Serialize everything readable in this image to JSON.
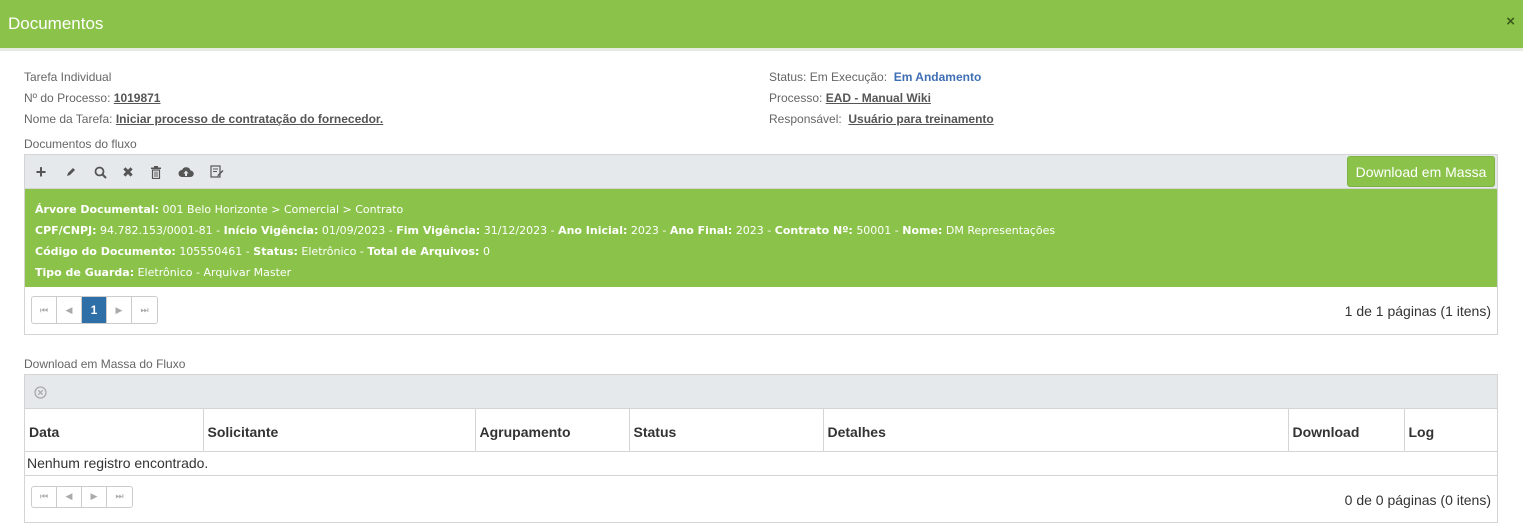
{
  "window": {
    "title": "Documentos",
    "close_label": "×"
  },
  "info_left": {
    "task_type": "Tarefa Individual",
    "process_number_label": "Nº do Processo:",
    "process_number": "1019871",
    "task_name_label": "Nome da Tarefa:",
    "task_name": "Iniciar processo de contratação do fornecedor."
  },
  "info_right": {
    "status_label": "Status: Em Execução:",
    "status_value": "Em Andamento",
    "process_label": "Processo:",
    "process_value": "EAD - Manual Wiki",
    "responsible_label": "Responsável:",
    "responsible_value": "Usuário para treinamento"
  },
  "flow_docs": {
    "section_label": "Documentos do fluxo",
    "toolbar_icons": [
      "add-icon",
      "edit-icon",
      "search-icon",
      "remove-icon",
      "delete-icon",
      "cloud-upload-icon",
      "edit-document-icon"
    ],
    "mass_download_button": "Download em Massa",
    "document": {
      "tree_label": "Árvore Documental:",
      "tree_value": "001 Belo Horizonte > Comercial > Contrato",
      "cpf_label": "CPF/CNPJ:",
      "cpf_value": "94.782.153/0001-81",
      "start_label": "Início Vigência:",
      "start_value": "01/09/2023",
      "end_label": "Fim Vigência:",
      "end_value": "31/12/2023",
      "year_start_label": "Ano Inicial:",
      "year_start_value": "2023",
      "year_end_label": "Ano Final:",
      "year_end_value": "2023",
      "contract_label": "Contrato Nº:",
      "contract_value": "50001",
      "name_label": "Nome:",
      "name_value": "DM Representações",
      "code_label": "Código do Documento:",
      "code_value": "105550461",
      "status_label": "Status:",
      "status_value": "Eletrônico",
      "files_label": "Total de Arquivos:",
      "files_value": "0",
      "guard_label": "Tipo de Guarda:",
      "guard_value": "Eletrônico - Arquivar Master",
      "separator": " - "
    },
    "pager": {
      "current_page": "1",
      "info": "1 de 1 páginas (1 itens)"
    }
  },
  "mass_download": {
    "section_label": "Download em Massa do Fluxo",
    "columns": [
      "Data",
      "Solicitante",
      "Agrupamento",
      "Status",
      "Detalhes",
      "Download",
      "Log"
    ],
    "empty_message": "Nenhum registro encontrado.",
    "pager": {
      "info": "0 de 0 páginas (0 itens)"
    }
  }
}
